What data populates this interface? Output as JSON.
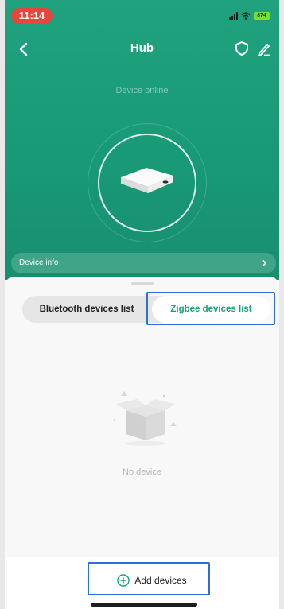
{
  "status_bar": {
    "time": "11:14",
    "battery": "874"
  },
  "nav": {
    "title": "Hub"
  },
  "hero": {
    "online_text": "Device online",
    "info_label": "Device info"
  },
  "tabs": [
    {
      "label": "Bluetooth devices list",
      "active": false
    },
    {
      "label": "Zigbee devices list",
      "active": true
    }
  ],
  "empty_state": {
    "text": "No device"
  },
  "footer": {
    "add_label": "Add devices"
  },
  "colors": {
    "brand_green": "#1fa27d",
    "highlight_blue": "#2d6fd6",
    "time_pill": "#e8453c"
  },
  "icons": [
    "back-arrow-icon",
    "shield-icon",
    "edit-pencil-icon",
    "chevron-right-icon",
    "hub-device-icon",
    "empty-box-icon",
    "add-circle-icon",
    "signal-icon",
    "wifi-icon",
    "battery-icon"
  ]
}
